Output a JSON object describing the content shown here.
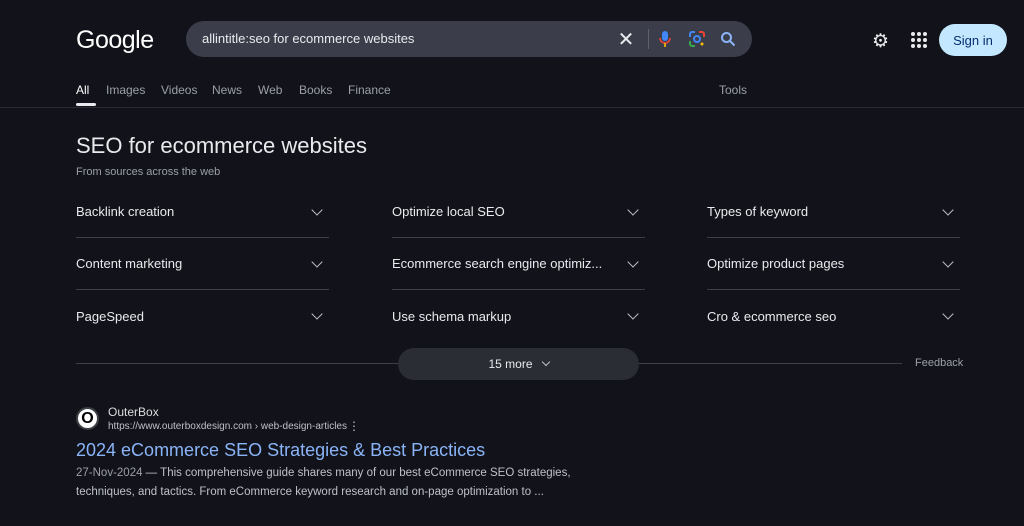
{
  "logo": "Google",
  "search": {
    "query": "allintitle:seo for ecommerce websites"
  },
  "header": {
    "sign_in": "Sign in"
  },
  "tabs": [
    {
      "label": "All",
      "active": true
    },
    {
      "label": "Images"
    },
    {
      "label": "Videos"
    },
    {
      "label": "News"
    },
    {
      "label": "Web"
    },
    {
      "label": "Books"
    },
    {
      "label": "Finance"
    }
  ],
  "tools": "Tools",
  "section": {
    "title": "SEO for ecommerce websites",
    "subtitle": "From sources across the web",
    "columns": [
      [
        "Backlink creation",
        "Content marketing",
        "PageSpeed"
      ],
      [
        "Optimize local SEO",
        "Ecommerce search engine optimiz...",
        "Use schema markup"
      ],
      [
        "Types of keyword",
        "Optimize product pages",
        "Cro & ecommerce seo"
      ]
    ],
    "more": "15 more",
    "feedback": "Feedback"
  },
  "result": {
    "favicon": "O",
    "site": "OuterBox",
    "url": "https://www.outerboxdesign.com › web-design-articles",
    "title": "2024 eCommerce SEO Strategies & Best Practices",
    "date": "27-Nov-2024",
    "snippet": " — This comprehensive guide shares many of our best eCommerce SEO strategies, techniques, and tactics. From eCommerce keyword research and on-page optimization to ..."
  },
  "colors": {
    "background": "#12131a",
    "link": "#8ab4f8",
    "sign_in_bg": "#c2e7ff"
  }
}
